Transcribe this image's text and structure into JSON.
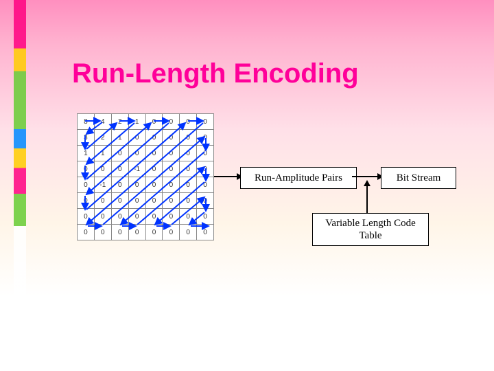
{
  "title": "Run-Length Encoding",
  "boxes": {
    "run_amplitude": "Run-Amplitude Pairs",
    "bit_stream": "Bit Stream",
    "vlc_line1": "Variable Length Code",
    "vlc_line2": "Table"
  },
  "dct_matrix": [
    [
      "8",
      "4",
      "2",
      "1",
      "0",
      "0",
      "0",
      "0"
    ],
    [
      "3",
      "2",
      "1",
      "0",
      "0",
      "0",
      "0",
      "0"
    ],
    [
      "1",
      "1",
      "0",
      "0",
      "0",
      "0",
      "0",
      "0"
    ],
    [
      "0",
      "0",
      "0",
      "-1",
      "0",
      "0",
      "0",
      "0"
    ],
    [
      "0",
      "-1",
      "0",
      "0",
      "0",
      "0",
      "0",
      "0"
    ],
    [
      "0",
      "0",
      "0",
      "0",
      "0",
      "0",
      "0",
      "0"
    ],
    [
      "0",
      "0",
      "0",
      "0",
      "0",
      "0",
      "0",
      "0"
    ],
    [
      "0",
      "0",
      "0",
      "0",
      "0",
      "0",
      "0",
      "0"
    ]
  ],
  "diagram_meaning": "An 8x8 quantized DCT coefficient block is scanned in zig-zag order, producing run-amplitude pairs which feed into a variable-length code table to emit a compressed bit stream."
}
